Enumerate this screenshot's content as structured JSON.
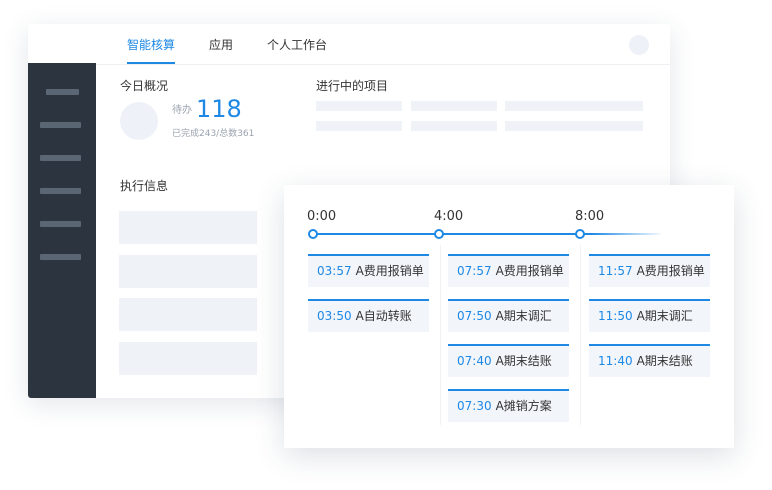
{
  "topbar": {
    "tabs": [
      {
        "label": "智能核算",
        "active": true
      },
      {
        "label": "应用",
        "active": false
      },
      {
        "label": "个人工作台",
        "active": false
      }
    ]
  },
  "overview": {
    "title": "今日概况",
    "pending_label": "待办",
    "pending_count": "118",
    "progress_text": "已完成243/总数361"
  },
  "projects": {
    "title": "进行中的项目"
  },
  "execution": {
    "title": "执行信息"
  },
  "timeline": {
    "time_labels": [
      "0:00",
      "4:00",
      "8:00"
    ],
    "columns": [
      [
        {
          "time": "03:57",
          "name": "A费用报销单"
        },
        {
          "time": "03:50",
          "name": "A自动转账"
        }
      ],
      [
        {
          "time": "07:57",
          "name": "A费用报销单"
        },
        {
          "time": "07:50",
          "name": "A期末调汇"
        },
        {
          "time": "07:40",
          "name": "A期末结账"
        },
        {
          "time": "07:30",
          "name": "A摊销方案"
        }
      ],
      [
        {
          "time": "11:57",
          "name": "A费用报销单"
        },
        {
          "time": "11:50",
          "name": "A期末调汇"
        },
        {
          "time": "11:40",
          "name": "A期末结账"
        }
      ]
    ]
  },
  "colors": {
    "accent": "#1e88e5",
    "sidebar": "#2c343f",
    "skeleton": "#eff3f8"
  }
}
